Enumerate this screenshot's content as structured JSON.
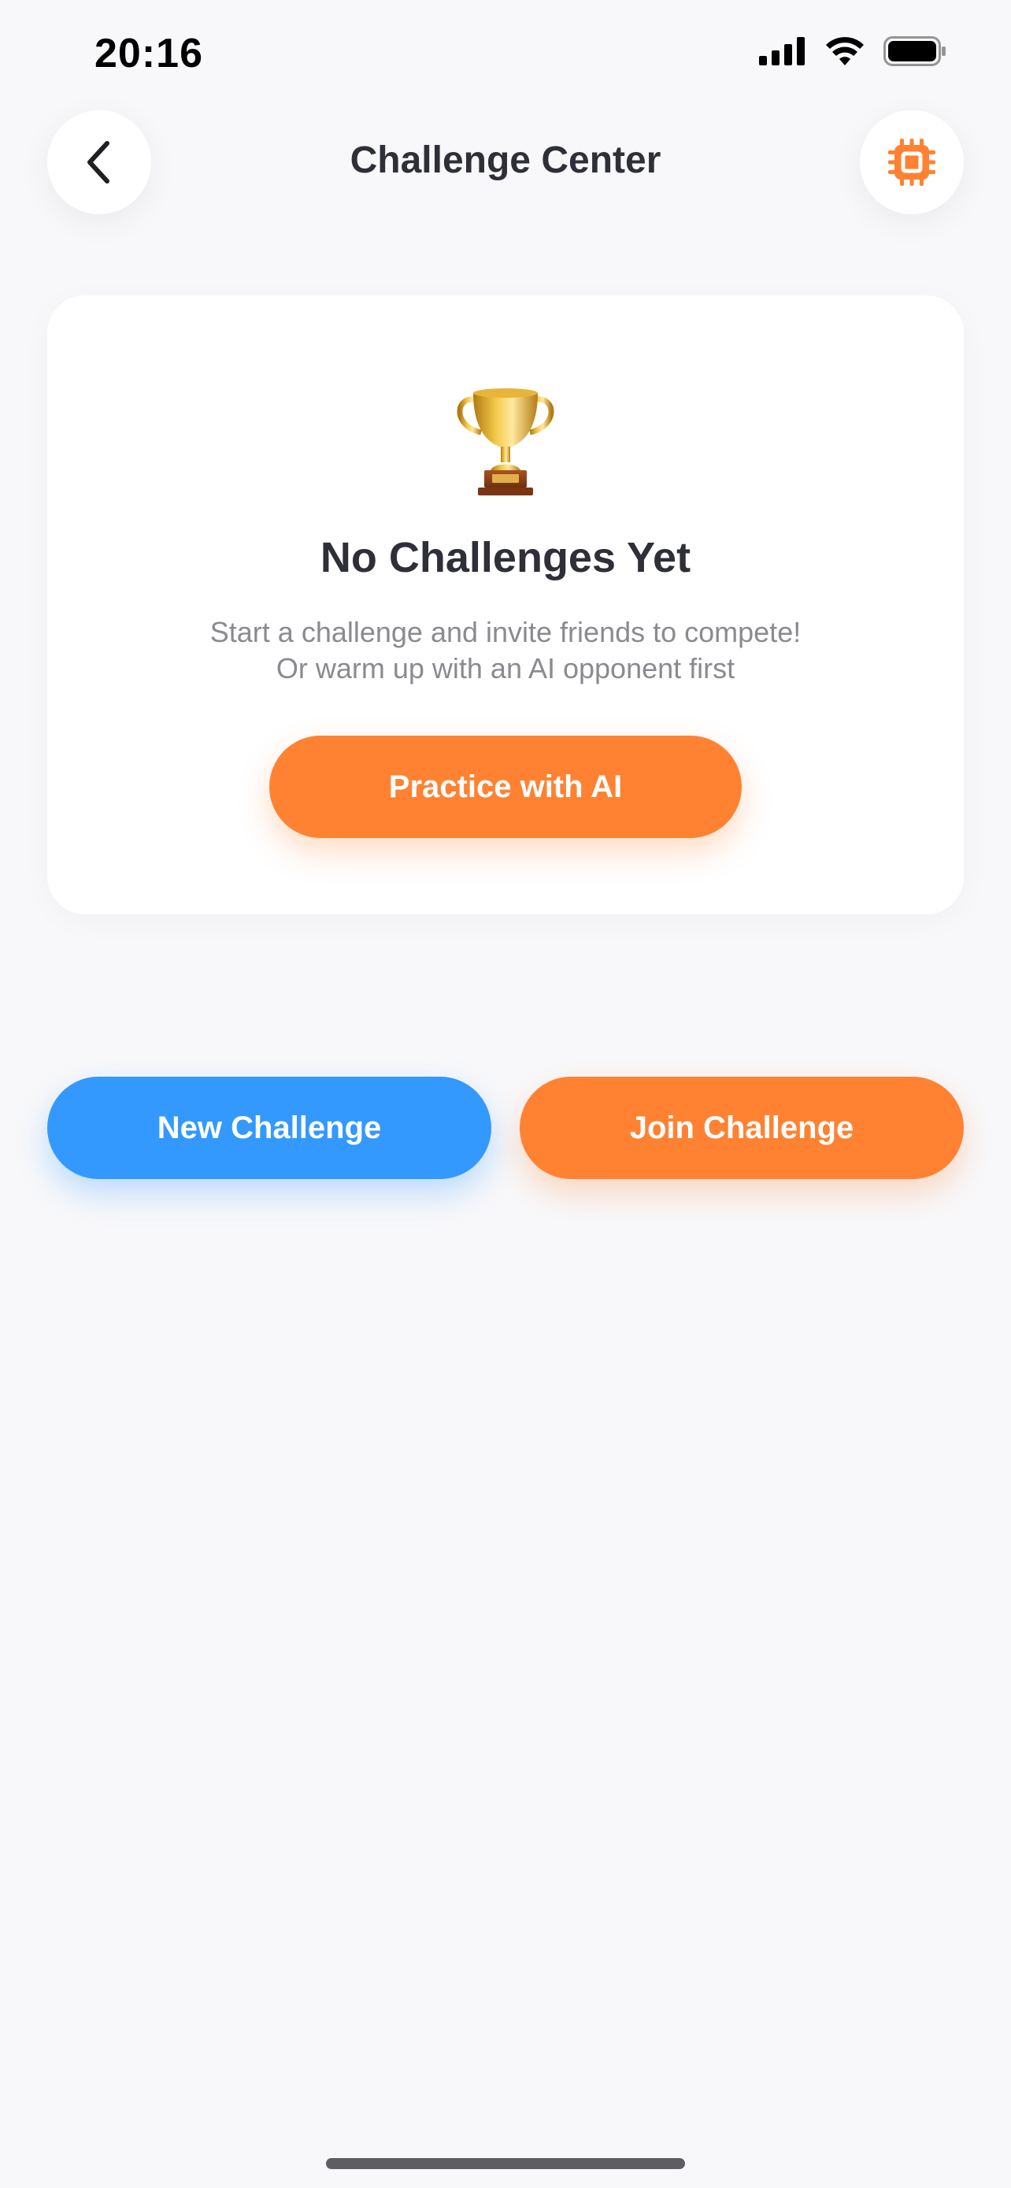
{
  "status_bar": {
    "time": "20:16",
    "icons": [
      "signal-icon",
      "wifi-icon",
      "battery-icon"
    ]
  },
  "header": {
    "title": "Challenge Center",
    "back_icon": "chevron-left-icon",
    "action_icon": "cpu-chip-icon"
  },
  "empty_state": {
    "icon": "trophy-icon",
    "title": "No Challenges Yet",
    "subtitle_line1": "Start a challenge and invite friends to compete!",
    "subtitle_line2": "Or warm up with an AI opponent first",
    "practice_label": "Practice with AI"
  },
  "actions": {
    "new_label": "New Challenge",
    "join_label": "Join Challenge"
  },
  "colors": {
    "accent_orange": "#FF8232",
    "accent_blue": "#3399FF",
    "background": "#F8F8FA",
    "card": "#FFFFFF",
    "title_text": "#2E2F38",
    "muted_text": "#8A8A90"
  }
}
